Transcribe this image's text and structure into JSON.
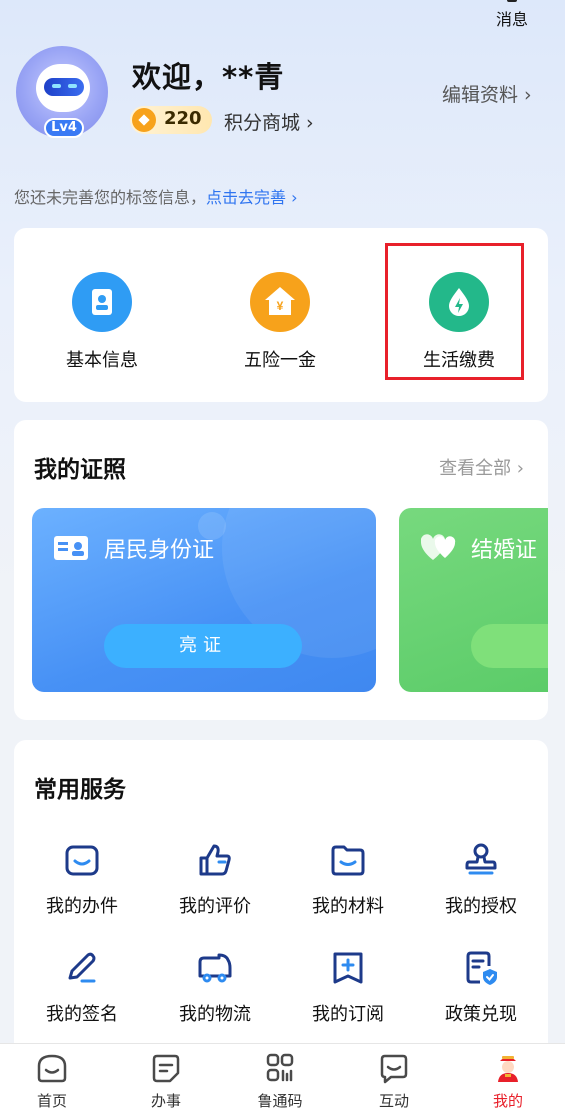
{
  "header": {
    "messages_label": "消息",
    "welcome": "欢迎，**青",
    "level": "Lv4",
    "points": "220",
    "points_mall": "积分商城 ›",
    "edit_profile": "编辑资料 ›"
  },
  "tag_hint": {
    "text": "您还未完善您的标签信息，",
    "link": "点击去完善 ›"
  },
  "quick": {
    "items": [
      {
        "label": "基本信息",
        "color": "#2f9cf4"
      },
      {
        "label": "五险一金",
        "color": "#f7a21b"
      },
      {
        "label": "生活缴费",
        "color": "#23b88a"
      }
    ]
  },
  "licenses": {
    "title": "我的证照",
    "view_all": "查看全部 ›",
    "id_card": {
      "title": "居民身份证",
      "button": "亮证"
    },
    "marriage": {
      "title": "结婚证"
    }
  },
  "services": {
    "title": "常用服务",
    "items": [
      {
        "label": "我的办件",
        "icon": "folder-smile-icon"
      },
      {
        "label": "我的评价",
        "icon": "thumbs-up-icon"
      },
      {
        "label": "我的材料",
        "icon": "folder-icon"
      },
      {
        "label": "我的授权",
        "icon": "stamp-icon"
      },
      {
        "label": "我的签名",
        "icon": "pen-icon"
      },
      {
        "label": "我的物流",
        "icon": "truck-icon"
      },
      {
        "label": "我的订阅",
        "icon": "bookmark-plus-icon"
      },
      {
        "label": "政策兑现",
        "icon": "document-shield-icon"
      }
    ]
  },
  "tabbar": {
    "tabs": [
      {
        "label": "首页",
        "icon": "home-icon"
      },
      {
        "label": "办事",
        "icon": "task-icon"
      },
      {
        "label": "鲁通码",
        "icon": "qr-code-icon"
      },
      {
        "label": "互动",
        "icon": "chat-icon"
      },
      {
        "label": "我的",
        "icon": "profile-mascot-icon",
        "active": true
      }
    ]
  },
  "colors": {
    "accent": "#2e74f0",
    "highlight": "#e8202a",
    "active_tab": "#e8202a"
  }
}
